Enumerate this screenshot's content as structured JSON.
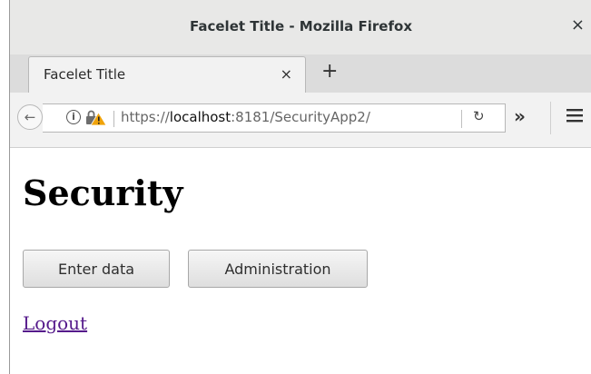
{
  "window": {
    "title": "Facelet Title - Mozilla Firefox",
    "close_glyph": "×"
  },
  "tab": {
    "title": "Facelet Title",
    "close_glyph": "×"
  },
  "newtab": {
    "glyph": "+"
  },
  "navbar": {
    "url_prefix": "https://",
    "url_host": "localhost",
    "url_rest": ":8181/SecurityApp2/",
    "icons": [
      "back-arrow-icon",
      "info-icon",
      "insecure-lock-icon",
      "reload-icon",
      "overflow-chevron-icon",
      "hamburger-menu-icon"
    ],
    "back_glyph": "←",
    "info_glyph": "i",
    "reload_glyph": "↻",
    "overflow_glyph": "»"
  },
  "page": {
    "heading": "Security",
    "buttons": {
      "enter": "Enter data",
      "admin": "Administration"
    },
    "logout": "Logout"
  },
  "colors": {
    "link": "#551a8b",
    "warning": "#f0a30a"
  }
}
